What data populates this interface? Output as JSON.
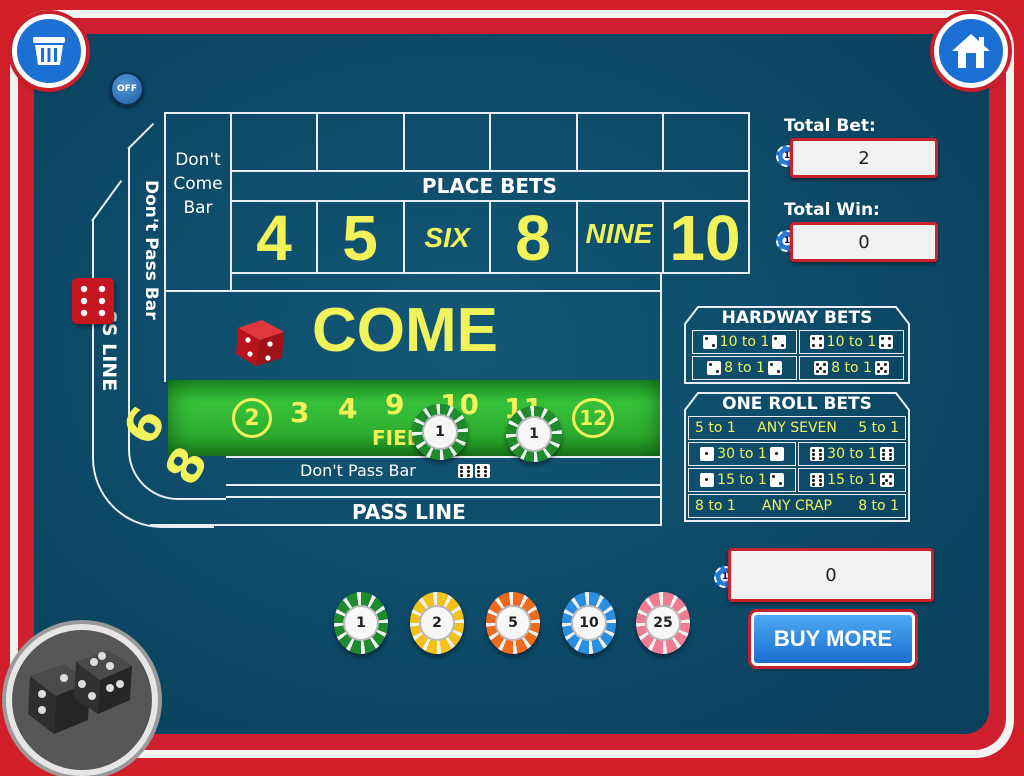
{
  "toolbar": {
    "sound_toggle_label": "OFF"
  },
  "table": {
    "dont_come_bar": [
      "Don't",
      "Come",
      "Bar"
    ],
    "dont_pass_bar_vertical": "Don't Pass Bar",
    "pass_line_vertical": "SS LINE",
    "place_bets_label": "PLACE BETS",
    "place_numbers": [
      "4",
      "5",
      "SIX",
      "8",
      "NINE",
      "10"
    ],
    "come_label": "COME",
    "field_numbers": [
      "2",
      "3",
      "4",
      "9",
      "10",
      "11",
      "12"
    ],
    "field_label": "FIELD",
    "big_numbers": [
      "6",
      "8"
    ],
    "dont_pass_bar_label": "Don't Pass Bar",
    "pass_line_label": "PASS LINE",
    "field_chip_values": [
      "1",
      "1"
    ]
  },
  "totals": {
    "total_bet_label": "Total Bet:",
    "total_bet_value": "2",
    "total_win_label": "Total Win:",
    "total_win_value": "0",
    "bank_value": "0",
    "chip_icon_value": "1"
  },
  "hardway": {
    "title": "HARDWAY BETS",
    "bets": [
      "10 to 1",
      "10 to 1",
      "8 to 1",
      "8 to 1"
    ]
  },
  "one_roll": {
    "title": "ONE ROLL BETS",
    "any_seven": [
      "5 to 1",
      "ANY SEVEN",
      "5 to 1"
    ],
    "bets": [
      "30 to 1",
      "30 to 1",
      "15 to 1",
      "15 to 1"
    ],
    "any_crap": [
      "8 to 1",
      "ANY CRAP",
      "8 to 1"
    ]
  },
  "chips": [
    {
      "value": "1",
      "color": "#1f8a2e"
    },
    {
      "value": "2",
      "color": "#f2c21b"
    },
    {
      "value": "5",
      "color": "#ee6a1c"
    },
    {
      "value": "10",
      "color": "#2b8ee0"
    },
    {
      "value": "25",
      "color": "#ee7c93"
    }
  ],
  "buy_more_label": "BUY MORE",
  "colors": {
    "felt": "#0d4a6b",
    "frame_red": "#cf2030",
    "accent_yellow": "#f2f25a",
    "field_green": "#2fae2f"
  }
}
